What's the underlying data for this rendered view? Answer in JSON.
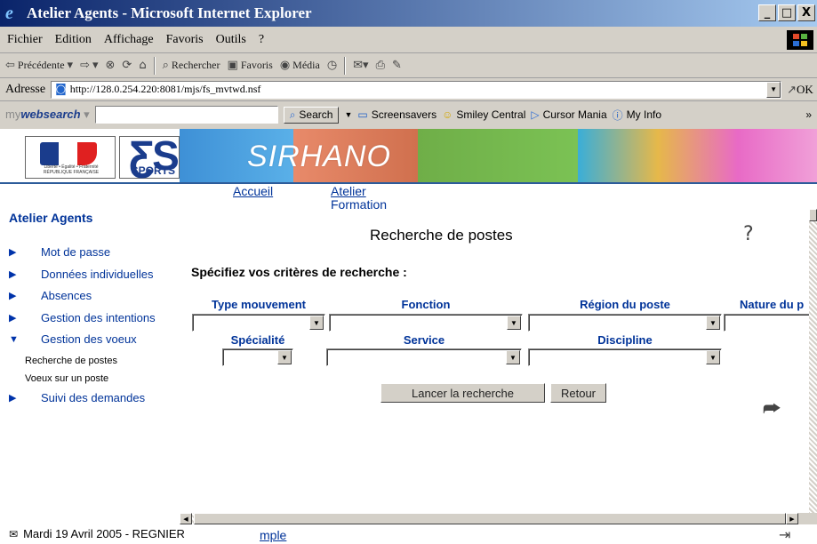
{
  "window": {
    "title": "Atelier Agents - Microsoft Internet Explorer",
    "buttons": [
      "_",
      "□",
      "X"
    ]
  },
  "menu": [
    "Fichier",
    "Edition",
    "Affichage",
    "Favoris",
    "Outils",
    "?"
  ],
  "toolbar": {
    "back": "Précédente",
    "search": "Rechercher",
    "favorites": "Favoris",
    "media": "Média"
  },
  "address": {
    "label": "Adresse",
    "url": "http://128.0.254.220:8081/mjs/fs_mvtwd.nsf",
    "go": "OK"
  },
  "searchbar": {
    "brand_prefix": "my",
    "brand_strong": "websearch",
    "search_button": "Search",
    "links": [
      "Screensavers",
      "Smiley Central",
      "Cursor Mania",
      "My Info"
    ]
  },
  "banner": {
    "logo_small_text": "Liberté • Égalité • Fraternité RÉPUBLIQUE FRANÇAISE",
    "js_letters": "ƸS",
    "sports": "SPORTS",
    "app_name": "SIRHANO"
  },
  "topnav": {
    "home": "Accueil",
    "atelier": "Atelier",
    "formation": "Formation"
  },
  "sidebar": {
    "title": "Atelier Agents",
    "items": [
      {
        "label": "Mot de passe",
        "expanded": false
      },
      {
        "label": "Données individuelles",
        "expanded": false
      },
      {
        "label": "Absences",
        "expanded": false
      },
      {
        "label": "Gestion des intentions",
        "expanded": false
      },
      {
        "label": "Gestion des voeux",
        "expanded": true
      },
      {
        "label": "Suivi des demandes",
        "expanded": false
      }
    ],
    "subitems": [
      "Recherche de postes",
      "Voeux sur un poste"
    ]
  },
  "main": {
    "title": "Recherche de postes",
    "criteria_heading": "Spécifiez vos critères de recherche :",
    "row1_labels": [
      "Type mouvement",
      "Fonction",
      "Région du poste",
      "Nature du p"
    ],
    "row2_labels": [
      "Spécialité",
      "Service",
      "Discipline"
    ],
    "search_button": "Lancer la recherche",
    "back_button": "Retour"
  },
  "status": {
    "date": "Mardi 19 Avril 2005 - REGNIER",
    "link": "mple"
  },
  "colors": {
    "link": "#003399",
    "title_gradient_start": "#0a246a",
    "chrome": "#d4d0c8"
  }
}
